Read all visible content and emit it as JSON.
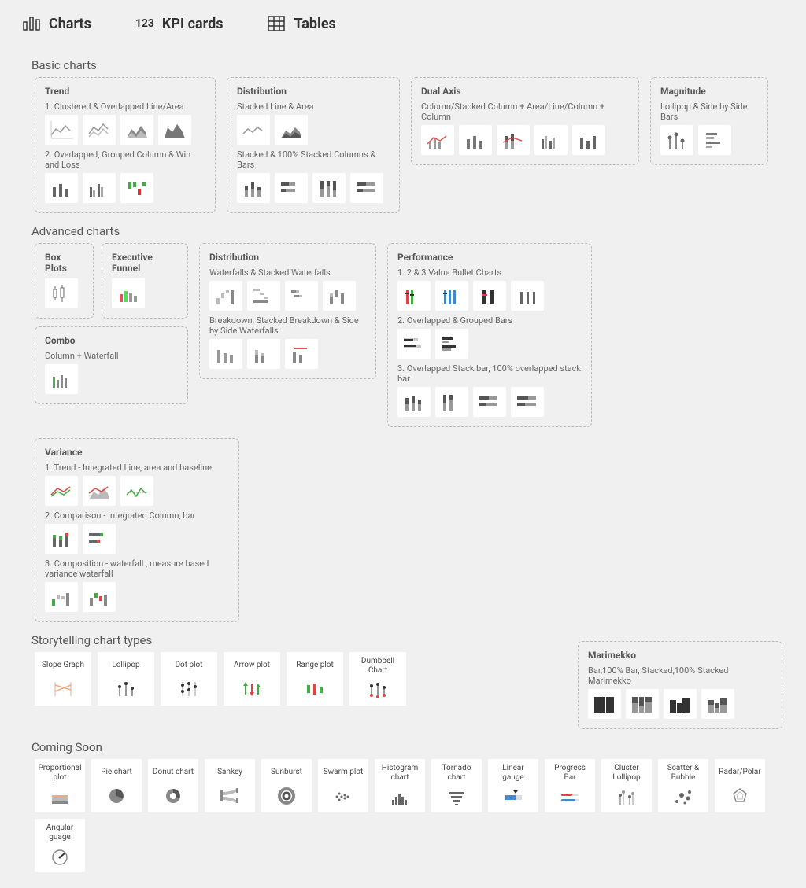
{
  "tabs": {
    "charts": "Charts",
    "kpi": "KPI cards",
    "tables": "Tables"
  },
  "sections": {
    "basic": "Basic charts",
    "advanced": "Advanced charts",
    "story": "Storytelling chart types",
    "coming": "Coming Soon"
  },
  "basic": {
    "trend": {
      "title": "Trend",
      "sub1": "1. Clustered & Overlapped Line/Area",
      "sub2": "2. Overlapped, Grouped Column & Win and Loss"
    },
    "distribution": {
      "title": "Distribution",
      "sub1": "Stacked Line & Area",
      "sub2": "Stacked & 100% Stacked Columns & Bars"
    },
    "dualaxis": {
      "title": "Dual Axis",
      "sub1": "Column/Stacked Column + Area/Line/Column + Column"
    },
    "magnitude": {
      "title": "Magnitude",
      "sub1": "Lollipop & Side by Side Bars"
    }
  },
  "advanced": {
    "boxplots": {
      "title": "Box Plots"
    },
    "funnel": {
      "title": "Executive Funnel"
    },
    "combo": {
      "title": "Combo",
      "sub1": "Column + Waterfall"
    },
    "distribution": {
      "title": "Distribution",
      "sub1": "Waterfalls & Stacked Waterfalls",
      "sub2": "Breakdown, Stacked Breakdown & Side by Side Waterfalls"
    },
    "performance": {
      "title": "Performance",
      "sub1": "1. 2 & 3 Value Bullet Charts",
      "sub2": "2. Overlapped & Grouped Bars",
      "sub3": "3. Overlapped Stack bar, 100% overlapped stack bar"
    },
    "variance": {
      "title": "Variance",
      "sub1": "1. Trend - Integrated Line, area and baseline",
      "sub2": "2. Comparison - Integrated Column, bar",
      "sub3": "3. Composition - waterfall , measure based variance waterfall"
    },
    "marimekko": {
      "title": "Marimekko",
      "sub1": "Bar,100% Bar, Stacked,100% Stacked Marimekko"
    }
  },
  "story": {
    "slope": "Slope Graph",
    "lollipop": "Lollipop",
    "dotplot": "Dot plot",
    "arrowplot": "Arrow plot",
    "rangeplot": "Range plot",
    "dumbbell": "Dumbbell Chart"
  },
  "coming": {
    "proportional": "Proportional plot",
    "pie": "Pie chart",
    "donut": "Donut chart",
    "sankey": "Sankey",
    "sunburst": "Sunburst",
    "swarm": "Swarm plot",
    "histogram": "Histogram chart",
    "tornado": "Tornado chart",
    "linear": "Linear gauge",
    "progress": "Progress Bar",
    "cluster": "Cluster Lollipop",
    "scatter": "Scatter & Bubble",
    "radar": "Radar/Polar",
    "angular": "Angular guage"
  }
}
